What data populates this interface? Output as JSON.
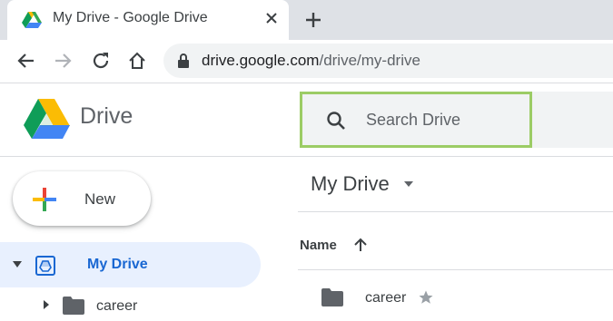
{
  "browser": {
    "tab_title": "My Drive - Google Drive",
    "url_host": "drive.google.com",
    "url_path": "/drive/my-drive",
    "icons": [
      "back-icon",
      "forward-icon",
      "reload-icon",
      "home-icon",
      "lock-icon",
      "close-icon",
      "plus-icon"
    ]
  },
  "header": {
    "app_name": "Drive",
    "search_placeholder": "Search Drive",
    "search_highlight_color": "#9ccc65"
  },
  "sidebar": {
    "new_label": "New",
    "items": [
      {
        "label": "My Drive",
        "selected": true,
        "expanded": true
      },
      {
        "label": "career",
        "selected": false,
        "expanded": false
      }
    ]
  },
  "main": {
    "breadcrumb": "My Drive",
    "sort_column": "Name",
    "sort_direction": "ascending",
    "files": [
      {
        "name": "career",
        "type": "folder",
        "starred": true
      }
    ]
  },
  "colors": {
    "accent": "#1967d2",
    "selected_bg": "#e8f0fe"
  }
}
